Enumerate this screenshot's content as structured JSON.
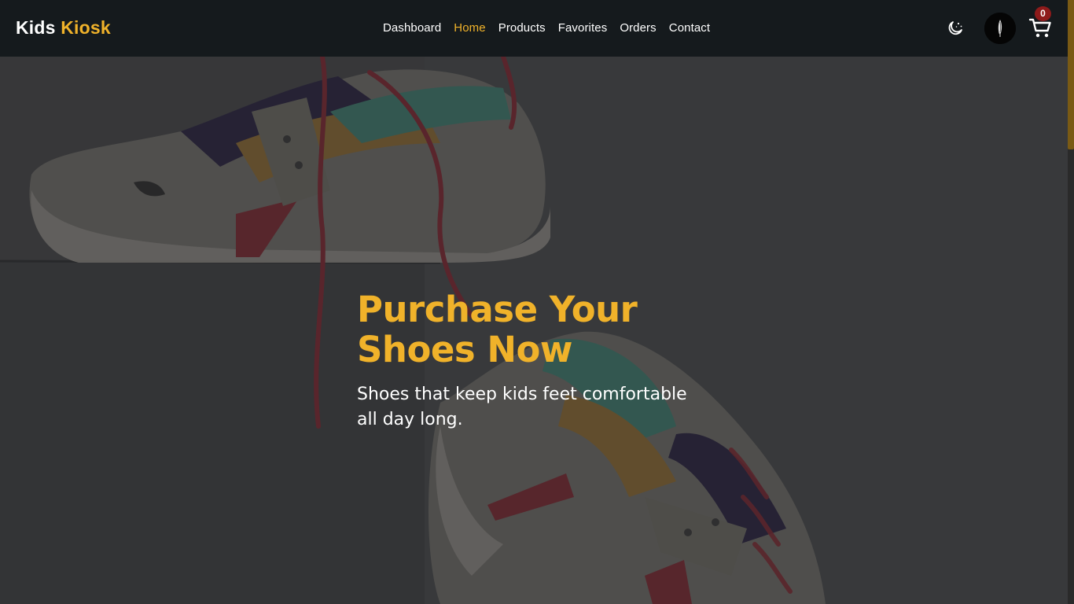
{
  "brand": {
    "part1": "Kids",
    "part2": "Kiosk"
  },
  "nav": {
    "items": [
      {
        "label": "Dashboard",
        "active": false
      },
      {
        "label": "Home",
        "active": true
      },
      {
        "label": "Products",
        "active": false
      },
      {
        "label": "Favorites",
        "active": false
      },
      {
        "label": "Orders",
        "active": false
      },
      {
        "label": "Contact",
        "active": false
      }
    ]
  },
  "header_actions": {
    "theme_icon": "moon-stars-icon",
    "avatar_icon": "user-avatar",
    "cart_icon": "cart-icon",
    "cart_count": "0"
  },
  "hero": {
    "title_line1": "Purchase Your",
    "title_line2": "Shoes Now",
    "subtitle": "Shoes that keep kids feet comfortable all day long."
  },
  "colors": {
    "accent": "#f0b22a",
    "navbar_bg": "#151a1d",
    "badge": "#8e1b1b"
  }
}
